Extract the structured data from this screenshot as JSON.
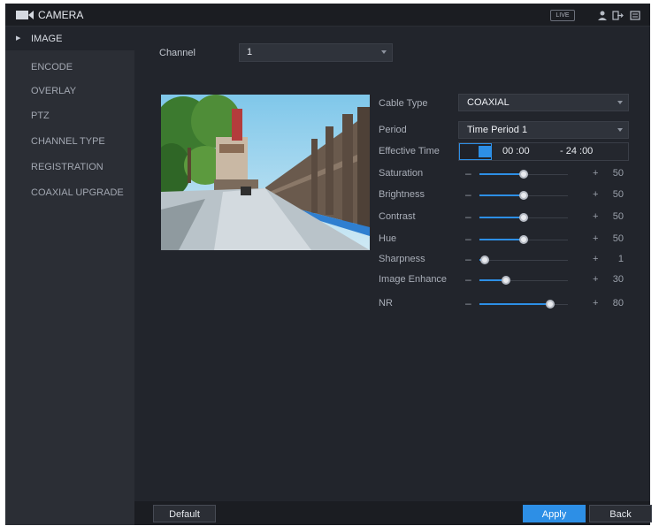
{
  "titlebar": {
    "title": "CAMERA",
    "live_label": "LIVE",
    "icons": [
      "camera-icon",
      "user-icon",
      "logout-icon",
      "menu-icon"
    ]
  },
  "sidebar": {
    "items": [
      {
        "label": "IMAGE",
        "active": true
      },
      {
        "label": "ENCODE"
      },
      {
        "label": "OVERLAY"
      },
      {
        "label": "PTZ"
      },
      {
        "label": "CHANNEL TYPE"
      },
      {
        "label": "REGISTRATION"
      },
      {
        "label": "COAXIAL UPGRADE"
      }
    ]
  },
  "channel": {
    "label": "Channel",
    "value": "1"
  },
  "settings": {
    "cable_type": {
      "label": "Cable Type",
      "value": "COAXIAL"
    },
    "period": {
      "label": "Period",
      "value": "Time Period 1"
    },
    "effective_time": {
      "label": "Effective Time",
      "start": "00 :00",
      "end": "- 24 :00"
    },
    "sliders": [
      {
        "label": "Saturation",
        "value": "50"
      },
      {
        "label": "Brightness",
        "value": "50"
      },
      {
        "label": "Contrast",
        "value": "50"
      },
      {
        "label": "Hue",
        "value": "50"
      },
      {
        "label": "Sharpness",
        "value": "1"
      },
      {
        "label": "Image Enhance",
        "value": "30"
      },
      {
        "label": "NR",
        "value": "80"
      }
    ]
  },
  "buttons": {
    "default": "Default",
    "apply": "Apply",
    "back": "Back"
  },
  "colors": {
    "accent": "#2d8fe6",
    "background": "#22252c",
    "sidebar": "#2b2e35"
  }
}
